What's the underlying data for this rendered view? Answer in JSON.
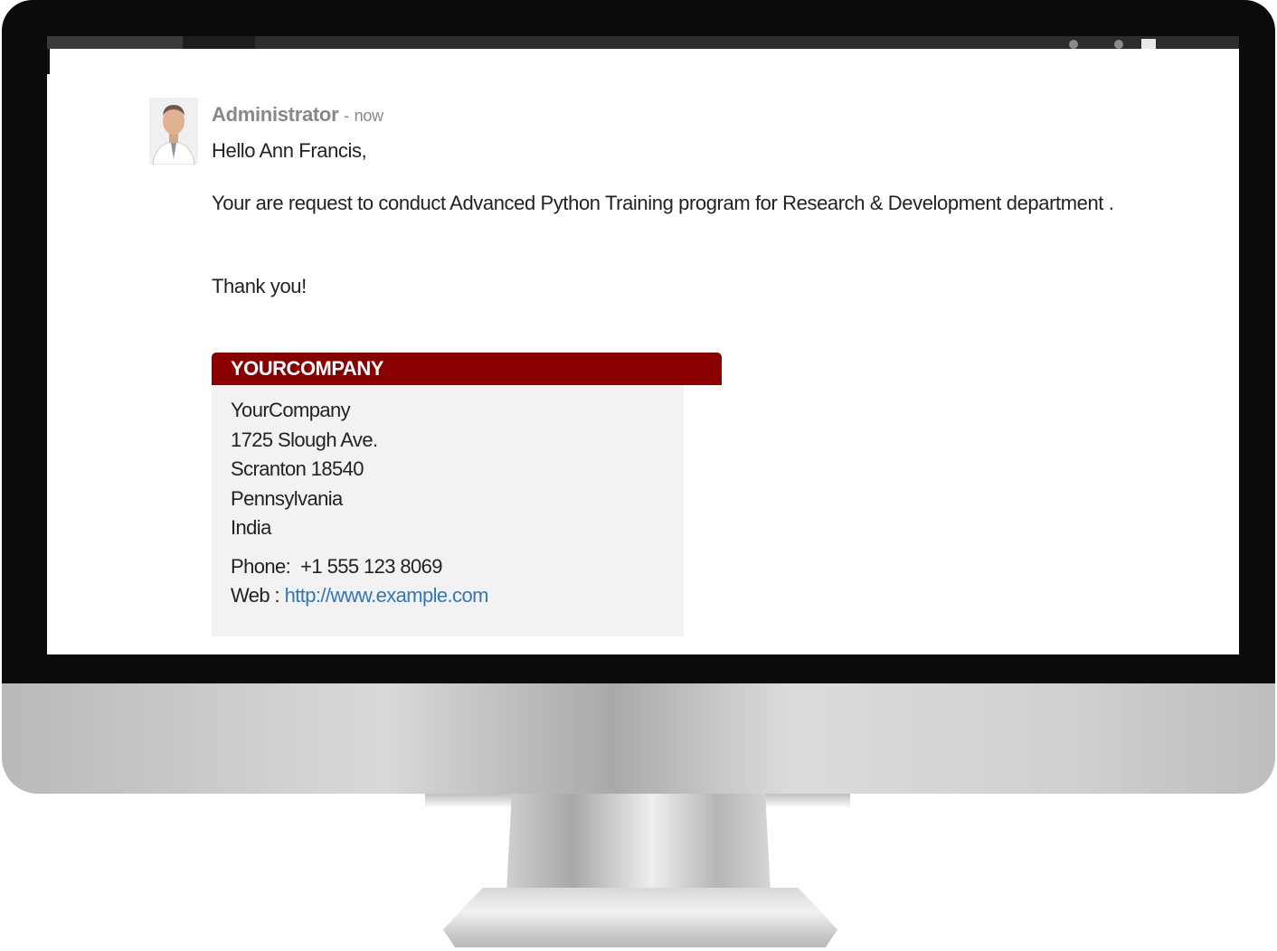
{
  "message": {
    "author": "Administrator",
    "separator": "-",
    "time": "now",
    "greeting": "Hello Ann Francis,",
    "request": "Your are request to conduct Advanced Python Training program for Research & Development department .",
    "thanks": "Thank you!"
  },
  "signature": {
    "header": "YOURCOMPANY",
    "company": "YourCompany",
    "street": "1725 Slough Ave.",
    "city": "Scranton 18540",
    "state": "Pennsylvania",
    "country": "India",
    "phone_label": "Phone:",
    "phone": "+1 555 123 8069",
    "web_label": "Web :",
    "web": "http://www.example.com"
  },
  "colors": {
    "header_bg": "#8a0000",
    "link": "#3377bb",
    "card_bg": "#f2f2f2"
  }
}
